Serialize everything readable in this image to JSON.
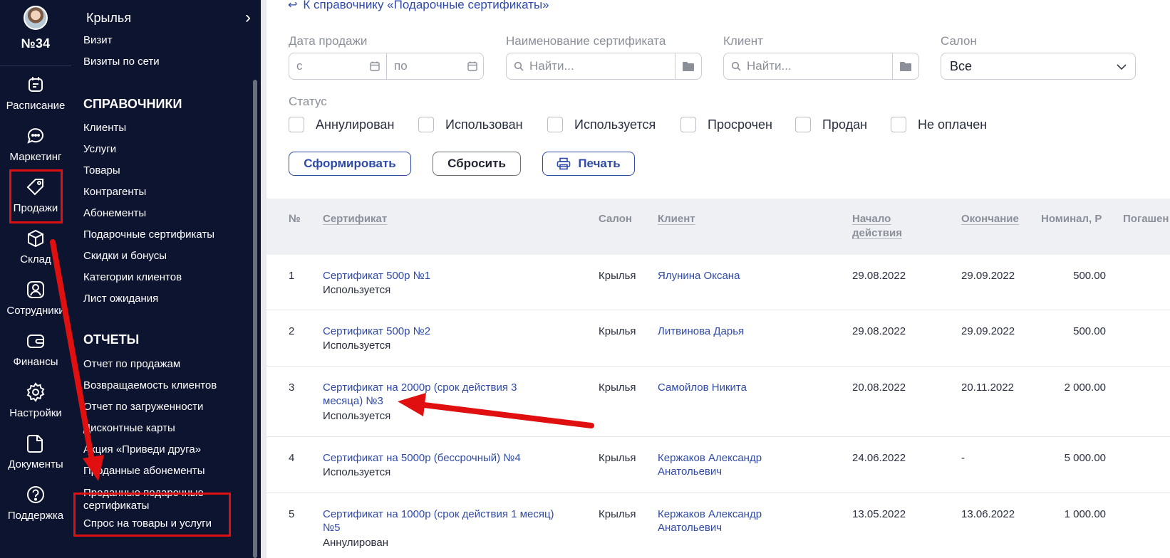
{
  "rail": {
    "salon_number": "№34",
    "items": [
      {
        "label": "Расписание",
        "icon": "calendar-icon"
      },
      {
        "label": "Маркетинг",
        "icon": "chat-icon"
      },
      {
        "label": "Продажи",
        "icon": "tag-icon"
      },
      {
        "label": "Склад",
        "icon": "box-icon"
      },
      {
        "label": "Сотрудники",
        "icon": "user-icon"
      },
      {
        "label": "Финансы",
        "icon": "wallet-icon"
      },
      {
        "label": "Настройки",
        "icon": "gear-icon"
      },
      {
        "label": "Документы",
        "icon": "document-icon"
      },
      {
        "label": "Поддержка",
        "icon": "help-icon"
      }
    ]
  },
  "menu": {
    "title": "Крылья",
    "top_links": [
      "Визит",
      "Визиты по сети"
    ],
    "directories_title": "СПРАВОЧНИКИ",
    "directories": [
      "Клиенты",
      "Услуги",
      "Товары",
      "Контрагенты",
      "Абонементы",
      "Подарочные сертификаты",
      "Скидки и бонусы",
      "Категории клиентов",
      "Лист ожидания"
    ],
    "reports_title": "ОТЧЕТЫ",
    "reports": [
      "Отчет по продажам",
      "Возвращаемость клиентов",
      "Отчет по загруженности",
      "Дисконтные карты",
      "Акция «Приведи друга»",
      "Проданные абонементы",
      "Проданные подарочные сертификаты",
      "Спрос на товары и услуги"
    ]
  },
  "content": {
    "back_link": "К справочнику «Подарочные сертификаты»",
    "filters": {
      "date_label": "Дата продажи",
      "date_from_placeholder": "с",
      "date_to_placeholder": "по",
      "cert_label": "Наименование сертификата",
      "cert_placeholder": "Найти...",
      "client_label": "Клиент",
      "client_placeholder": "Найти...",
      "salon_label": "Салон",
      "salon_value": "Все",
      "status_label": "Статус",
      "statuses": [
        "Аннулирован",
        "Использован",
        "Используется",
        "Просрочен",
        "Продан",
        "Не оплачен"
      ]
    },
    "buttons": {
      "generate": "Сформировать",
      "reset": "Сбросить",
      "print": "Печать"
    },
    "table": {
      "columns": [
        "№",
        "Сертификат",
        "Салон",
        "Клиент",
        "Начало действия",
        "Окончание",
        "Номинал, Р",
        "Погашен"
      ],
      "rows": [
        {
          "num": "1",
          "certificate": "Сертификат 500р №1",
          "status": "Используется",
          "salon": "Крылья",
          "client": "Ялунина Оксана",
          "start": "29.08.2022",
          "end": "29.09.2022",
          "nominal": "500.00"
        },
        {
          "num": "2",
          "certificate": "Сертификат 500р №2",
          "status": "Используется",
          "salon": "Крылья",
          "client": "Литвинова Дарья",
          "start": "29.08.2022",
          "end": "29.09.2022",
          "nominal": "500.00"
        },
        {
          "num": "3",
          "certificate": "Сертификат на 2000р (срок действия 3 месяца) №3",
          "status": "Используется",
          "salon": "Крылья",
          "client": "Самойлов Никита",
          "start": "20.08.2022",
          "end": "20.11.2022",
          "nominal": "2 000.00"
        },
        {
          "num": "4",
          "certificate": "Сертификат на 5000р (бессрочный) №4",
          "status": "Используется",
          "salon": "Крылья",
          "client": "Кержаков Александр Анатольевич",
          "start": "24.06.2022",
          "end": "-",
          "nominal": "5 000.00"
        },
        {
          "num": "5",
          "certificate": "Сертификат на 1000р (срок действия 1 месяц) №5",
          "status": "Аннулирован",
          "salon": "Крылья",
          "client": "Кержаков Александр Анатольевич",
          "start": "13.05.2022",
          "end": "13.06.2022",
          "nominal": "1 000.00"
        }
      ]
    }
  },
  "colors": {
    "sidebar_bg": "#0d1430",
    "accent": "#2f4aa8",
    "annotation": "#e01010"
  }
}
